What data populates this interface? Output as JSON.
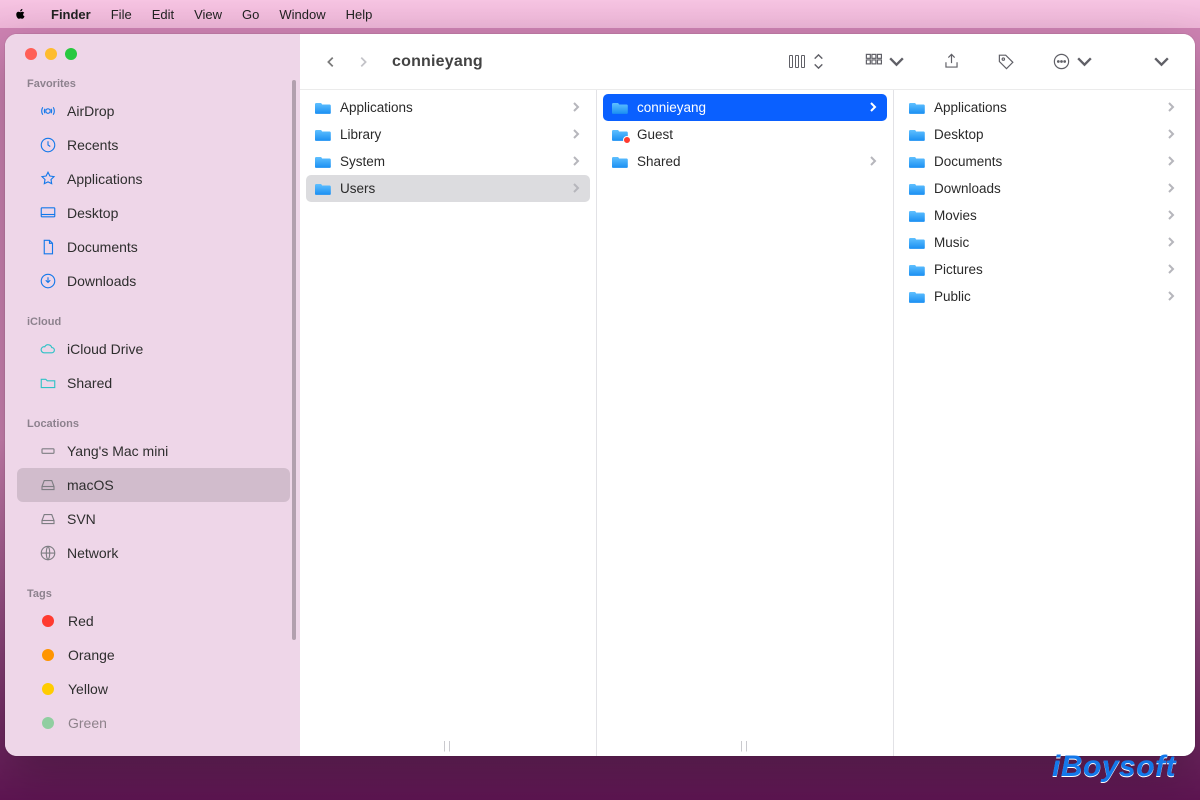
{
  "menubar": {
    "app": "Finder",
    "items": [
      "File",
      "Edit",
      "View",
      "Go",
      "Window",
      "Help"
    ]
  },
  "window": {
    "title": "connieyang"
  },
  "toolbar": {
    "back_icon": "chevron-left",
    "forward_icon": "chevron-right",
    "view_icon": "columns-view",
    "grid_icon": "icon-grid",
    "share_icon": "share",
    "tag_icon": "tag",
    "more_icon": "ellipsis",
    "search_icon": "overflow"
  },
  "sidebar": {
    "sections": [
      {
        "heading": "Favorites",
        "items": [
          {
            "icon": "airdrop",
            "label": "AirDrop"
          },
          {
            "icon": "clock",
            "label": "Recents"
          },
          {
            "icon": "apps",
            "label": "Applications"
          },
          {
            "icon": "desktop",
            "label": "Desktop"
          },
          {
            "icon": "doc",
            "label": "Documents"
          },
          {
            "icon": "download",
            "label": "Downloads"
          }
        ]
      },
      {
        "heading": "iCloud",
        "items": [
          {
            "icon": "cloud",
            "label": "iCloud Drive"
          },
          {
            "icon": "sharedfolder",
            "label": "Shared"
          }
        ]
      },
      {
        "heading": "Locations",
        "items": [
          {
            "icon": "macmini",
            "label": "Yang's Mac mini"
          },
          {
            "icon": "drive",
            "label": "macOS",
            "selected": true
          },
          {
            "icon": "drive",
            "label": "SVN"
          },
          {
            "icon": "globe",
            "label": "Network"
          }
        ]
      },
      {
        "heading": "Tags",
        "items": [
          {
            "icon": "tag",
            "color": "#ff3b30",
            "label": "Red"
          },
          {
            "icon": "tag",
            "color": "#ff9500",
            "label": "Orange"
          },
          {
            "icon": "tag",
            "color": "#ffcc00",
            "label": "Yellow"
          },
          {
            "icon": "tag",
            "color": "#34c759",
            "label": "Green"
          }
        ]
      }
    ]
  },
  "columns": [
    {
      "items": [
        {
          "label": "Applications",
          "arrow": true
        },
        {
          "label": "Library",
          "arrow": true
        },
        {
          "label": "System",
          "arrow": true
        },
        {
          "label": "Users",
          "arrow": true,
          "selected": true
        }
      ]
    },
    {
      "items": [
        {
          "label": "connieyang",
          "arrow": true,
          "highlight": true
        },
        {
          "label": "Guest",
          "special": "guest"
        },
        {
          "label": "Shared",
          "arrow": true
        }
      ]
    },
    {
      "items": [
        {
          "label": "Applications",
          "arrow": true
        },
        {
          "label": "Desktop",
          "arrow": true
        },
        {
          "label": "Documents",
          "arrow": true
        },
        {
          "label": "Downloads",
          "arrow": true
        },
        {
          "label": "Movies",
          "arrow": true
        },
        {
          "label": "Music",
          "arrow": true
        },
        {
          "label": "Pictures",
          "arrow": true
        },
        {
          "label": "Public",
          "arrow": true
        }
      ]
    }
  ],
  "watermark": "iBoysoft"
}
